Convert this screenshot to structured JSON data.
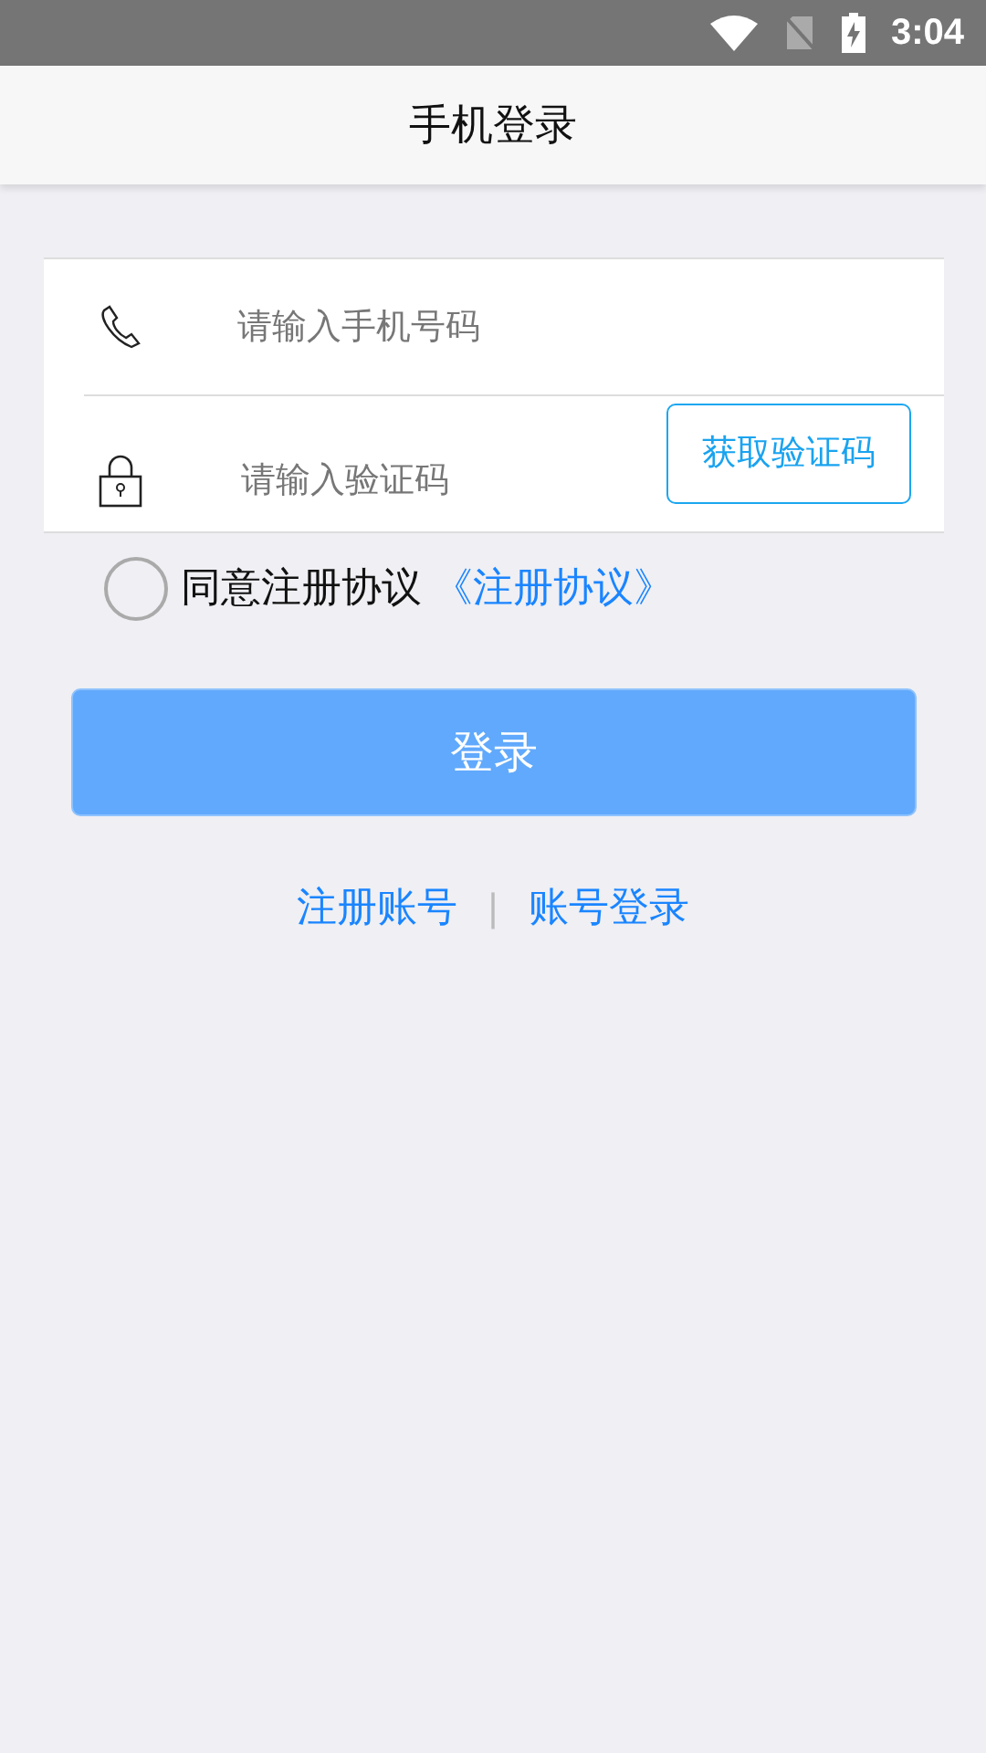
{
  "status_bar": {
    "time": "3:04"
  },
  "header": {
    "title": "手机登录"
  },
  "form": {
    "phone": {
      "placeholder": "请输入手机号码"
    },
    "code": {
      "placeholder": "请输入验证码"
    },
    "get_code_button": "获取验证码"
  },
  "agreement": {
    "checked": false,
    "text": "同意注册协议",
    "link": "《注册协议》"
  },
  "login_button": "登录",
  "links": [
    {
      "label": "注册账号"
    },
    {
      "label": "账号登录"
    }
  ],
  "link_separator": "|"
}
